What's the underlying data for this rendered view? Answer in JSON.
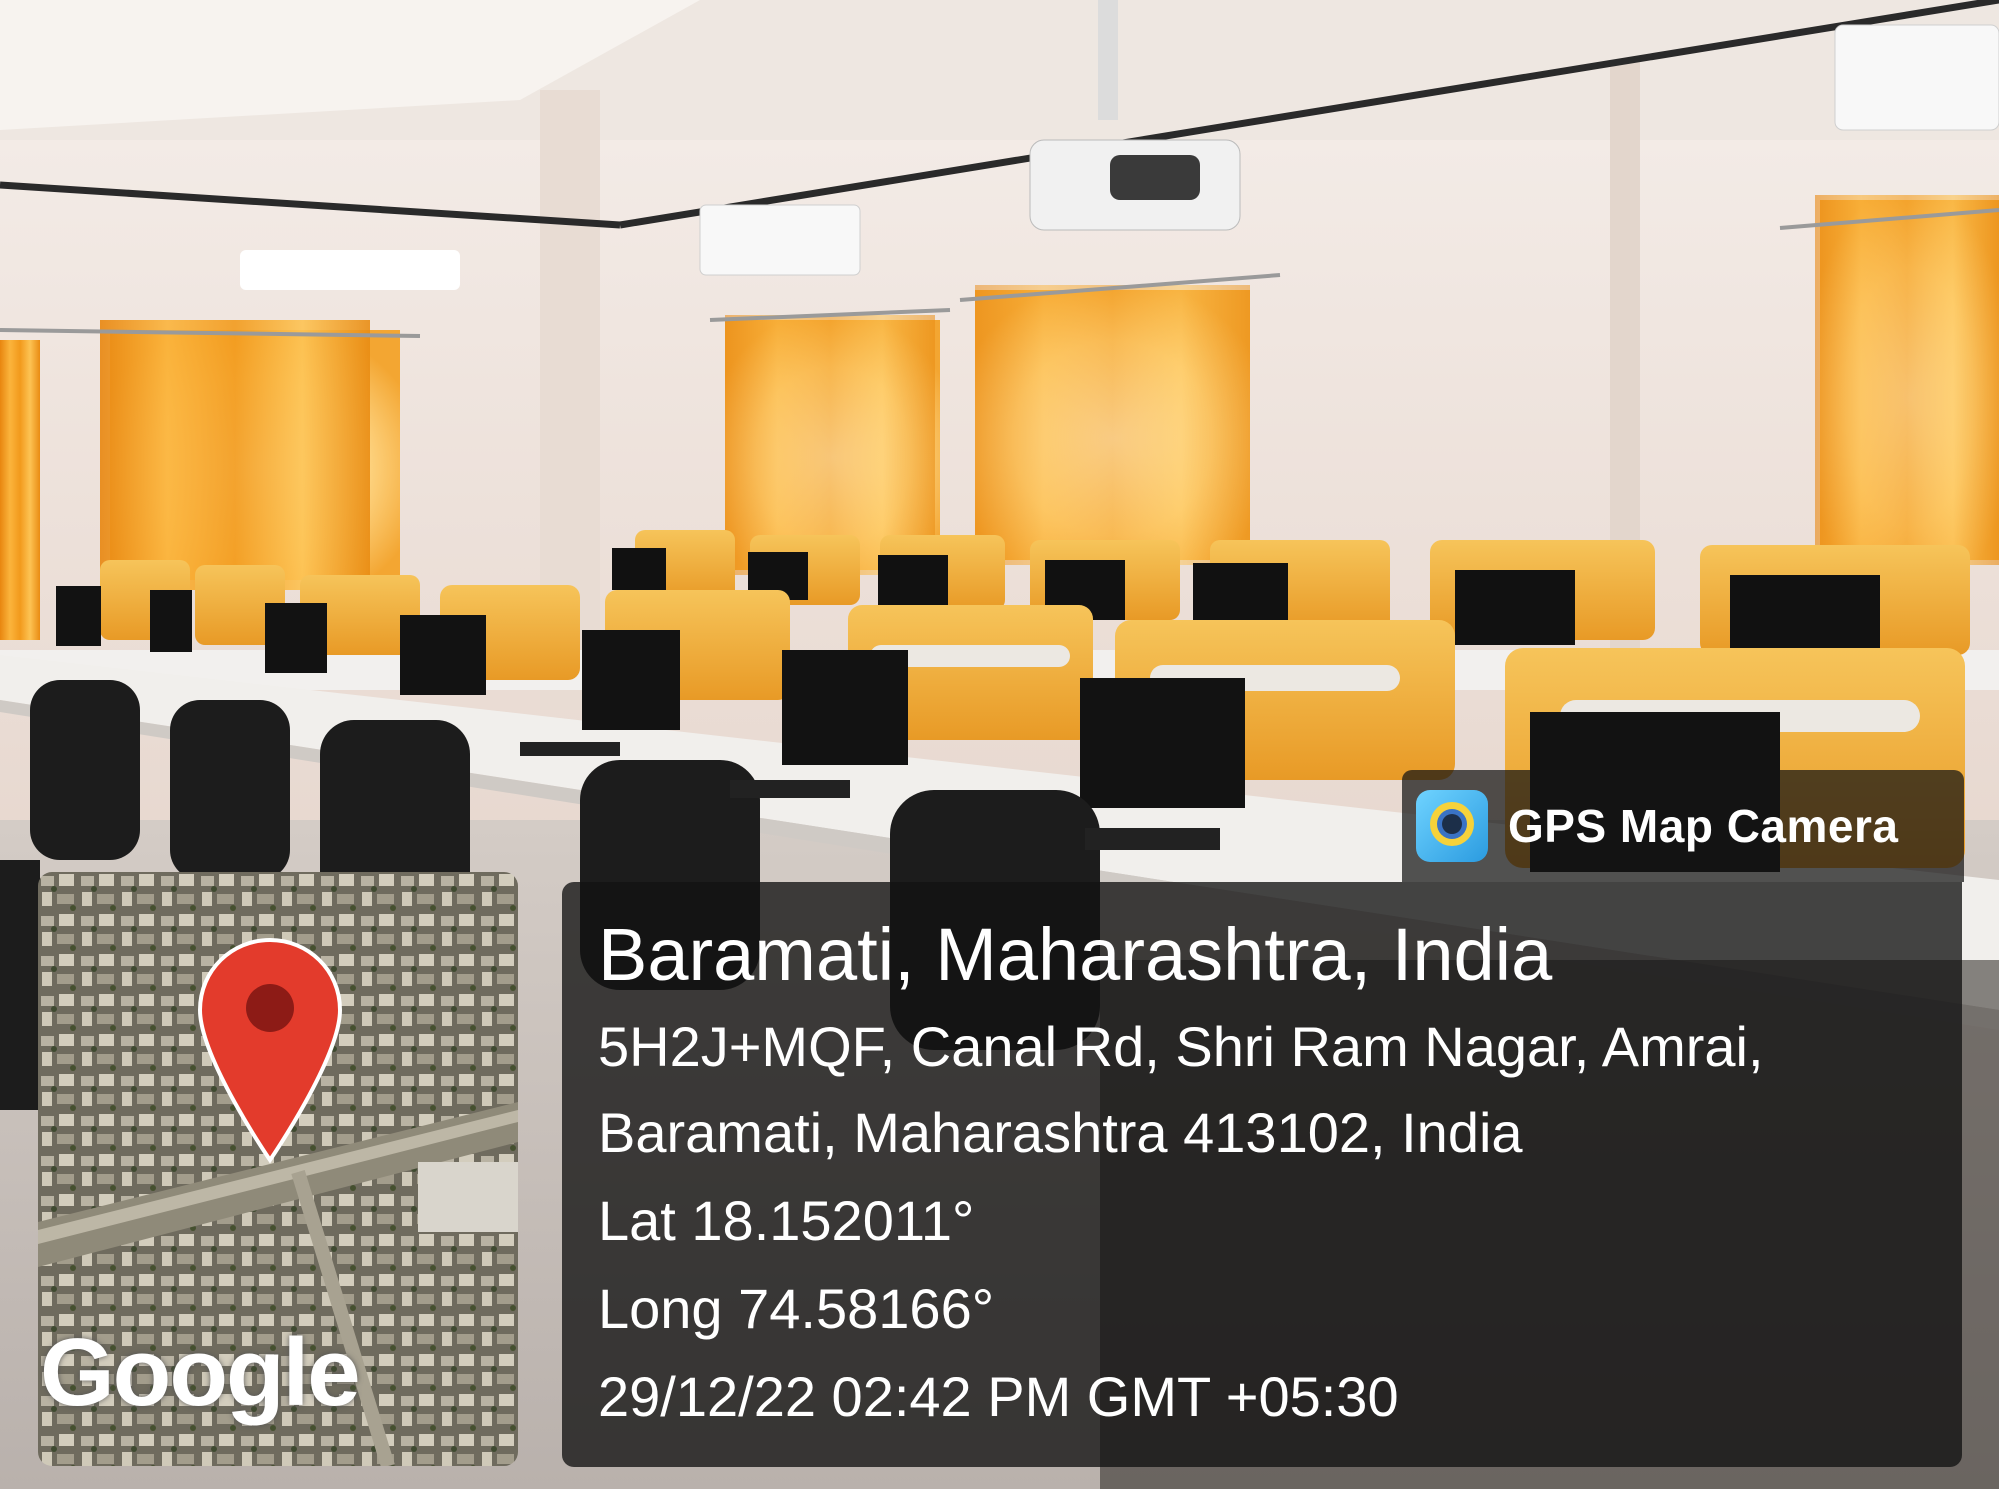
{
  "stamp": {
    "app_icon": "gps-map-camera-icon",
    "app_name": "GPS Map Camera",
    "location_title": "Baramati, Maharashtra, India",
    "address_line1": "5H2J+MQF, Canal Rd, Shri Ram Nagar, Amrai,",
    "address_line2": "Baramati, Maharashtra 413102, India",
    "latitude": "Lat 18.152011°",
    "longitude": "Long 74.58166°",
    "timestamp": "29/12/22 02:42 PM GMT +05:30"
  },
  "map": {
    "pin_icon": "map-pin-icon",
    "pin_color": "#e33b2c",
    "watermark": "Google"
  },
  "colors": {
    "curtain": "#f2a21e",
    "divider_panel": "#f2b53a",
    "wall": "#efe4dd",
    "overlay": "#121212"
  }
}
